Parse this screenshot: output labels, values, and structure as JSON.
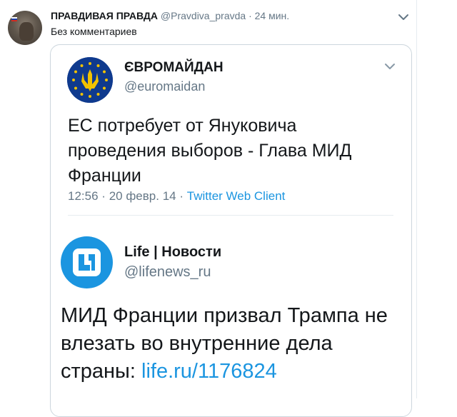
{
  "tweet": {
    "author_name": "ПРАВДИВАЯ ПРАВДА",
    "author_handle": "@Pravdiva_pravda",
    "separator": "·",
    "time": "24 мин.",
    "comment": "Без комментариев",
    "avatar_icon": "bear-avatar-icon",
    "menu_icon": "chevron-down-icon"
  },
  "quoted": {
    "author_name": "ЄВРОМАЙДАН",
    "author_handle": "@euromaidan",
    "text": "ЕС потребует от Януковича проведения выборов - Глава МИД Франции",
    "time": "12:56",
    "sep1": "·",
    "date": "20 февр. 14",
    "sep2": "·",
    "client": "Twitter Web Client",
    "avatar_icon": "euromaidan-logo-icon",
    "menu_icon": "chevron-down-icon"
  },
  "nested": {
    "author_name": "Life | Новости",
    "author_handle": "@lifenews_ru",
    "text": "МИД Франции призвал Трампа не влезать во внутренние дела страны: ",
    "link": "life.ru/1176824",
    "avatar_icon": "life-logo-icon"
  },
  "colors": {
    "link": "#1b95e0",
    "muted": "#657786",
    "text": "#14171a",
    "euromaidan_blue": "#0f3a8e",
    "euromaidan_gold": "#f2c200",
    "life_blue": "#1b95e0"
  }
}
